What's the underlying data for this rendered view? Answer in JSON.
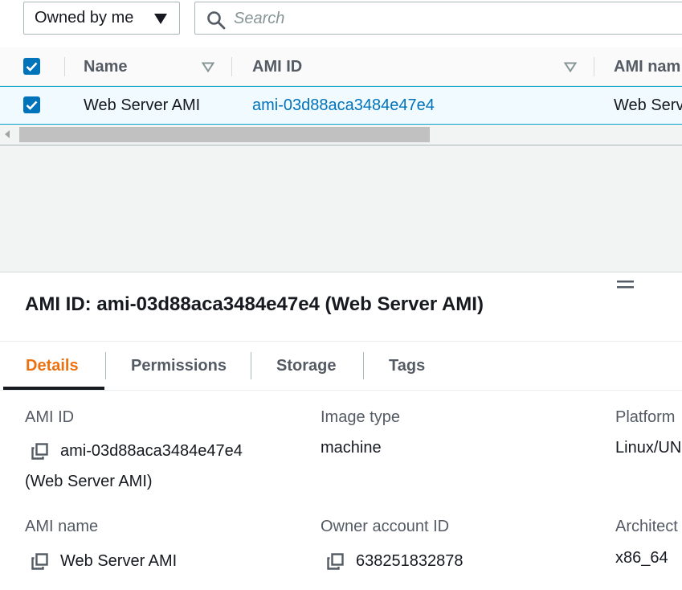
{
  "filter": {
    "owner_select_value": "Owned by me",
    "search_placeholder": "Search"
  },
  "table": {
    "columns": [
      "Name",
      "AMI ID",
      "AMI nam"
    ],
    "rows": [
      {
        "name": "Web Server AMI",
        "ami_id": "ami-03d88aca3484e47e4",
        "ami_name": "Web Serv",
        "selected": true
      }
    ]
  },
  "panel": {
    "title": "AMI ID: ami-03d88aca3484e47e4 (Web Server AMI)",
    "tabs": [
      {
        "label": "Details",
        "active": true
      },
      {
        "label": "Permissions",
        "active": false
      },
      {
        "label": "Storage",
        "active": false
      },
      {
        "label": "Tags",
        "active": false
      }
    ],
    "details": {
      "ami_id_label": "AMI ID",
      "ami_id_value": "ami-03d88aca3484e47e4",
      "ami_id_value_suffix": "(Web Server AMI)",
      "image_type_label": "Image type",
      "image_type_value": "machine",
      "platform_label": "Platform",
      "platform_value": "Linux/UN",
      "ami_name_label": "AMI name",
      "ami_name_value": "Web Server AMI",
      "owner_label": "Owner account ID",
      "owner_value": "638251832878",
      "architecture_label": "Architect",
      "architecture_value": "x86_64"
    }
  },
  "colors": {
    "accent_blue": "#0073bb",
    "active_tab_orange": "#ec7211",
    "selected_row_bg": "#f1faff"
  },
  "icons": [
    "chevron-down-icon",
    "search-icon",
    "sort-icon",
    "check-icon",
    "copy-icon",
    "drag-handle-icon",
    "scroll-left-icon"
  ]
}
